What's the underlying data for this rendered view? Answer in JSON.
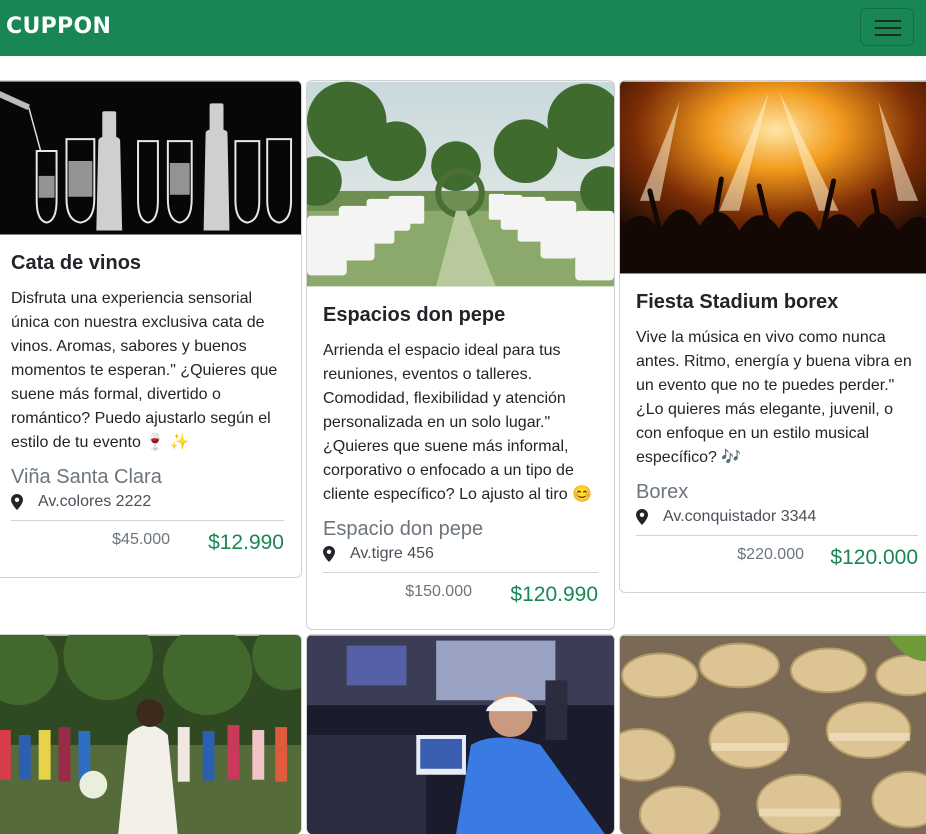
{
  "navbar": {
    "brand": "CUPPON",
    "brand_color": "#198754",
    "toggle_icon": "hamburger-menu-icon"
  },
  "cards": [
    {
      "title": "Cata de vinos",
      "description": "Disfruta una experiencia sensorial única con nuestra exclusiva cata de vinos. Aromas, sabores y buenos momentos te esperan.\" ¿Quieres que suene más formal, divertido o romántico? Puedo ajustarlo según el estilo de tu evento 🍷 ✨",
      "business": "Viña Santa Clara",
      "address": "Av.colores 2222",
      "old_price": "$45.000",
      "new_price": "$12.990",
      "image": "wine-glasses-and-bottles"
    },
    {
      "title": "Espacios don pepe",
      "description": "Arrienda el espacio ideal para tus reuniones, eventos o talleres. Comodidad, flexibilidad y atención personalizada en un solo lugar.\" ¿Quieres que suene más informal, corporativo o enfocado a un tipo de cliente específico? Lo ajusto al tiro 😊",
      "business": "Espacio don pepe",
      "address": "Av.tigre 456",
      "old_price": "$150.000",
      "new_price": "$120.990",
      "image": "outdoor-wedding-venue"
    },
    {
      "title": "Fiesta Stadium borex",
      "description": "Vive la música en vivo como nunca antes. Ritmo, energía y buena vibra en un evento que no te puedes perder.\" ¿Lo quieres más elegante, juvenil, o con enfoque en un estilo musical específico? 🎶",
      "business": "Borex",
      "address": "Av.conquistador 3344",
      "old_price": "$220.000",
      "new_price": "$120.000",
      "image": "concert-crowd-stage-lights"
    },
    {
      "image": "bride-with-guests-garden"
    },
    {
      "image": "dj-at-mixing-console"
    },
    {
      "image": "macarons-close-up"
    }
  ]
}
